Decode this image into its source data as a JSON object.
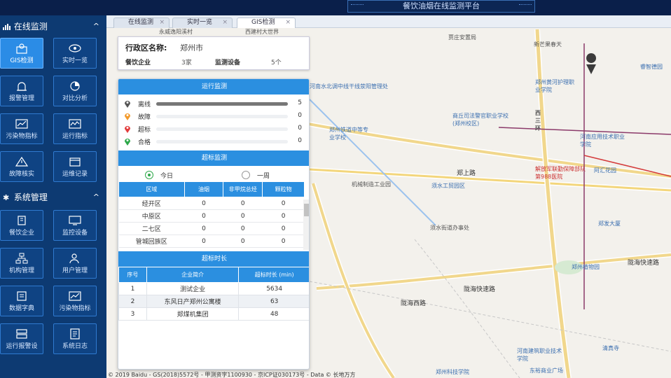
{
  "header": {
    "title": "餐饮油烟在线监测平台"
  },
  "sidebar": {
    "section1": {
      "label": "在线监测",
      "chevron": "^"
    },
    "tiles1": [
      {
        "label": "GIS检测",
        "icon": "map-pin-icon",
        "active": true
      },
      {
        "label": "实时一览",
        "icon": "eye-icon"
      },
      {
        "label": "报警管理",
        "icon": "alarm-icon"
      },
      {
        "label": "对比分析",
        "icon": "pie-chart-icon"
      },
      {
        "label": "污染物指标",
        "icon": "chart-icon"
      },
      {
        "label": "运行指标",
        "icon": "line-chart-icon"
      },
      {
        "label": "故障核实",
        "icon": "warning-icon"
      },
      {
        "label": "运维记录",
        "icon": "calendar-icon"
      }
    ],
    "section2": {
      "label": "系统管理",
      "chevron": "^"
    },
    "tiles2": [
      {
        "label": "餐饮企业",
        "icon": "building-icon"
      },
      {
        "label": "监控设备",
        "icon": "monitor-icon"
      },
      {
        "label": "机构管理",
        "icon": "org-icon"
      },
      {
        "label": "用户管理",
        "icon": "user-icon"
      },
      {
        "label": "数据字典",
        "icon": "dictionary-icon"
      },
      {
        "label": "污染物指标",
        "icon": "chart-icon"
      },
      {
        "label": "运行报警设",
        "icon": "server-icon"
      },
      {
        "label": "系统日志",
        "icon": "log-icon"
      }
    ]
  },
  "tabs": [
    {
      "label": "在线监测",
      "close": "×"
    },
    {
      "label": "实时一览",
      "close": "×"
    },
    {
      "label": "GIS检测",
      "close": "×",
      "active": true
    }
  ],
  "region": {
    "name_label": "行政区名称:",
    "name_value": "郑州市",
    "enterprise_label": "餐饮企业",
    "enterprise_value": "3家",
    "device_label": "监测设备",
    "device_value": "5个"
  },
  "run_monitor": {
    "title": "运行监测",
    "rows": [
      {
        "label": "离线",
        "count": "5",
        "fraction": 1.0,
        "color": "#555555"
      },
      {
        "label": "故障",
        "count": "0",
        "fraction": 0,
        "color": "#f39a2b"
      },
      {
        "label": "超标",
        "count": "0",
        "fraction": 0,
        "color": "#e23b3b"
      },
      {
        "label": "合格",
        "count": "0",
        "fraction": 0,
        "color": "#2ea84a"
      }
    ]
  },
  "exceed_monitor": {
    "title": "超标监测",
    "radio_today": "今日",
    "radio_week": "一周",
    "columns": [
      "区域",
      "油烟",
      "非甲烷总烃",
      "颗粒物"
    ],
    "rows": [
      [
        "经开区",
        "0",
        "0",
        "0"
      ],
      [
        "中原区",
        "0",
        "0",
        "0"
      ],
      [
        "二七区",
        "0",
        "0",
        "0"
      ],
      [
        "管城回族区",
        "0",
        "0",
        "0"
      ]
    ]
  },
  "exceed_duration": {
    "title": "超标时长",
    "columns": [
      "序号",
      "企业简介",
      "超标时长 (min)"
    ],
    "rows": [
      [
        "1",
        "测试企业",
        "5634"
      ],
      [
        "2",
        "东风日产郑州公寓楼",
        "63"
      ],
      [
        "3",
        "郑煤机集团",
        "48"
      ]
    ]
  },
  "map": {
    "labels": [
      "西建村大世界",
      "永威逸阳溪村",
      "贾庄安置局",
      "新芒果春天",
      "睿智德园",
      "河南水北调中线干线荥阳管理处",
      "郑州黄河护理职业学院",
      "商丘司法警官职业学校(郑州校区)",
      "郑州铁道中等专业学校",
      "西三环",
      "河南应用技术职业学院",
      "郑上路",
      "解放军联勤保障部队第988医院",
      "阿汇花园",
      "机械制造工业园",
      "须水工贸园区",
      "须水街道办事处",
      "郑发大厦",
      "郑州植物园",
      "陇海快速路",
      "陇海西路",
      "河南建筑职业技术学院",
      "清真寺",
      "郑州科技学院",
      "东裕商业广场"
    ],
    "copyright": "© 2019 Baidu - GS(2018)5572号 - 甲测资字1100930 - 京ICP证030173号 - Data © 长地万方"
  }
}
